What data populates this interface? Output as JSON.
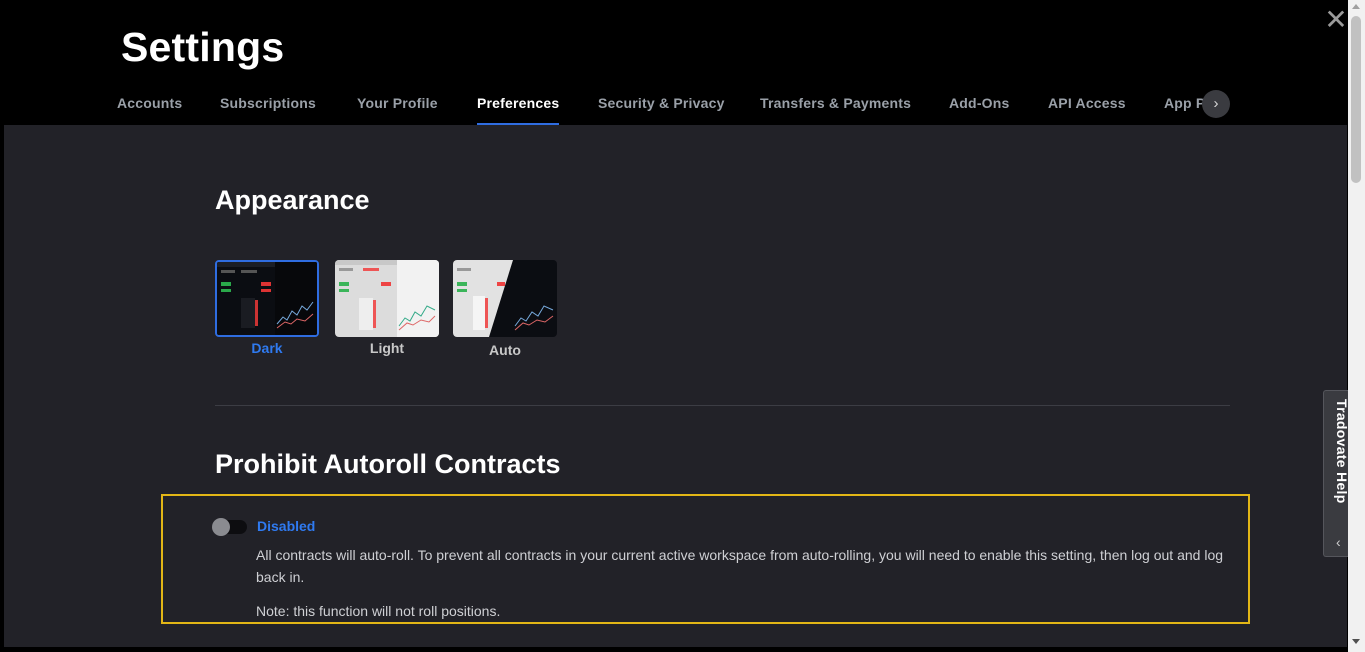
{
  "header": {
    "title": "Settings",
    "close_glyph": "✕"
  },
  "tabs": [
    {
      "label": "Accounts",
      "active": false
    },
    {
      "label": "Subscriptions",
      "active": false
    },
    {
      "label": "Your Profile",
      "active": false
    },
    {
      "label": "Preferences",
      "active": true
    },
    {
      "label": "Security & Privacy",
      "active": false
    },
    {
      "label": "Transfers & Payments",
      "active": false
    },
    {
      "label": "Add-Ons",
      "active": false
    },
    {
      "label": "API Access",
      "active": false
    },
    {
      "label": "App P",
      "active": false
    }
  ],
  "tabs_next_icon": "chevron-right-icon",
  "appearance": {
    "title": "Appearance",
    "themes": [
      {
        "label": "Dark",
        "selected": true
      },
      {
        "label": "Light",
        "selected": false
      },
      {
        "label": "Auto",
        "selected": false
      }
    ]
  },
  "autoroll": {
    "title": "Prohibit Autoroll Contracts",
    "toggle_state": "Disabled",
    "description": "All contracts will auto-roll. To prevent all contracts in your current active workspace from auto-rolling, you will need to enable this setting, then log out and log back in.",
    "note": "Note: this function will not roll positions."
  },
  "help": {
    "label": "Tradovate Help",
    "chevron": "‹"
  },
  "colors": {
    "accent": "#2f6de1",
    "highlight": "#e2b616",
    "background": "#222228"
  }
}
